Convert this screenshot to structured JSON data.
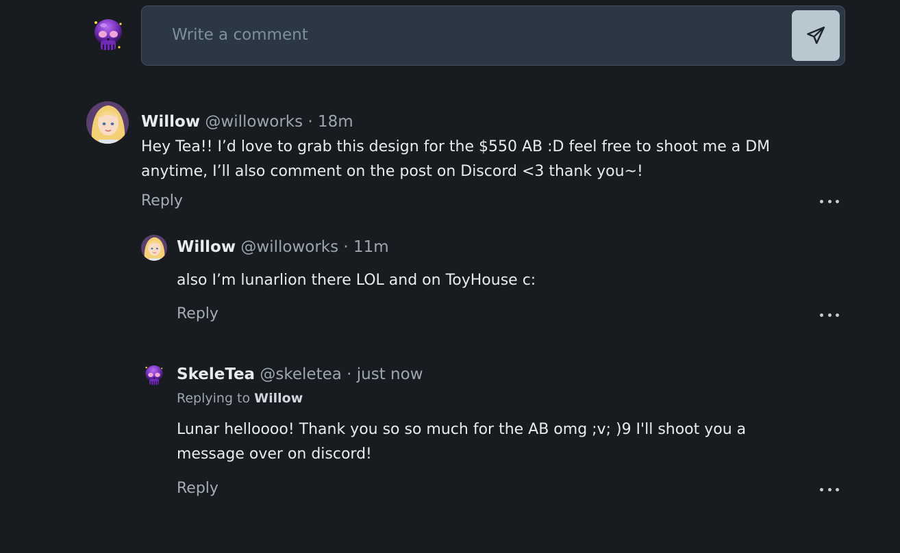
{
  "composer": {
    "placeholder": "Write a comment",
    "value": "",
    "send_icon": "paper-plane-icon",
    "avatar": "skull-avatar"
  },
  "comments": [
    {
      "author": "Willow",
      "handle": "@willoworks",
      "separator": "·",
      "time": "18m",
      "avatar": "blonde-girl-avatar",
      "text": "Hey Tea!! I’d love to grab this design for the $550 AB :D feel free to shoot me a DM anytime, I’ll also comment on the post on Discord <3 thank you~!",
      "reply_label": "Reply",
      "more_icon": "more-horizontal-icon"
    },
    {
      "author": "Willow",
      "handle": "@willoworks",
      "separator": "·",
      "time": "11m",
      "avatar": "blonde-girl-avatar",
      "text": "also I’m lunarlion there LOL and on ToyHouse c:",
      "reply_label": "Reply",
      "more_icon": "more-horizontal-icon"
    },
    {
      "author": "SkeleTea",
      "handle": "@skeletea",
      "separator": "·",
      "time": "just now",
      "avatar": "skull-avatar",
      "replying_prefix": "Replying to",
      "replying_to": "Willow",
      "text": "Lunar helloooo! Thank you so so much for the AB omg ;v; )9 I'll shoot you a message over on discord!",
      "reply_label": "Reply",
      "more_icon": "more-horizontal-icon"
    }
  ],
  "colors": {
    "background": "#181c20",
    "composer_bg": "#2b3743",
    "send_button": "#b9c7d1",
    "text_primary": "#e7ebee",
    "text_muted": "#9ba6ae"
  }
}
